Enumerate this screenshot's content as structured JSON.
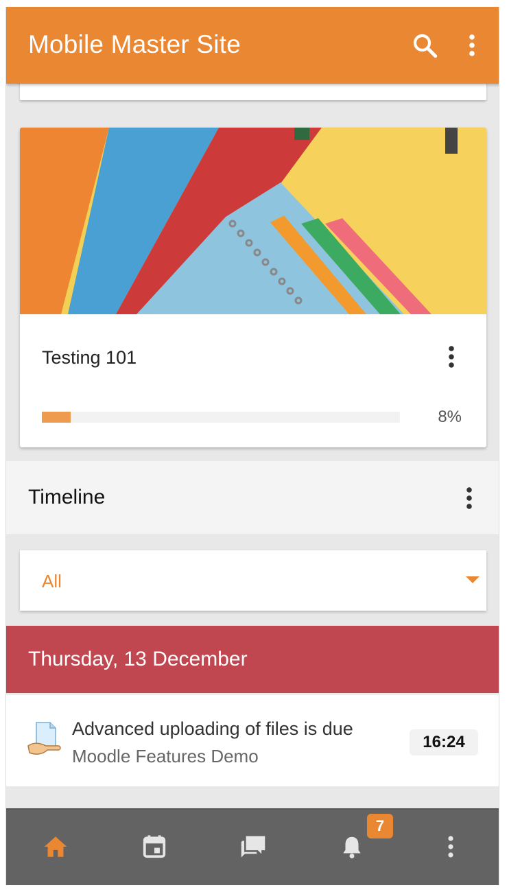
{
  "app": {
    "title": "Mobile Master Site"
  },
  "header": {
    "search_icon": "search-icon",
    "menu_icon": "more-vertical-icon"
  },
  "course": {
    "name": "Testing 101",
    "progress_percent": 8,
    "progress_label": "8%"
  },
  "timeline": {
    "title": "Timeline",
    "filter": {
      "selected": "All"
    },
    "groups": [
      {
        "date": "Thursday, 13 December",
        "events": [
          {
            "title": "Advanced uploading of files is due",
            "course": "Moodle Features Demo",
            "time": "16:24",
            "icon": "assignment-icon"
          }
        ]
      }
    ]
  },
  "tabs": [
    {
      "name": "home",
      "icon": "home-icon",
      "active": true
    },
    {
      "name": "calendar",
      "icon": "calendar-icon",
      "active": false
    },
    {
      "name": "messages",
      "icon": "messages-icon",
      "active": false
    },
    {
      "name": "notifications",
      "icon": "bell-icon",
      "active": false,
      "badge": "7"
    },
    {
      "name": "more",
      "icon": "more-vertical-icon",
      "active": false
    }
  ],
  "colors": {
    "brand": "#ea8733",
    "date_band": "#c0474f",
    "tabbar": "#636363"
  }
}
